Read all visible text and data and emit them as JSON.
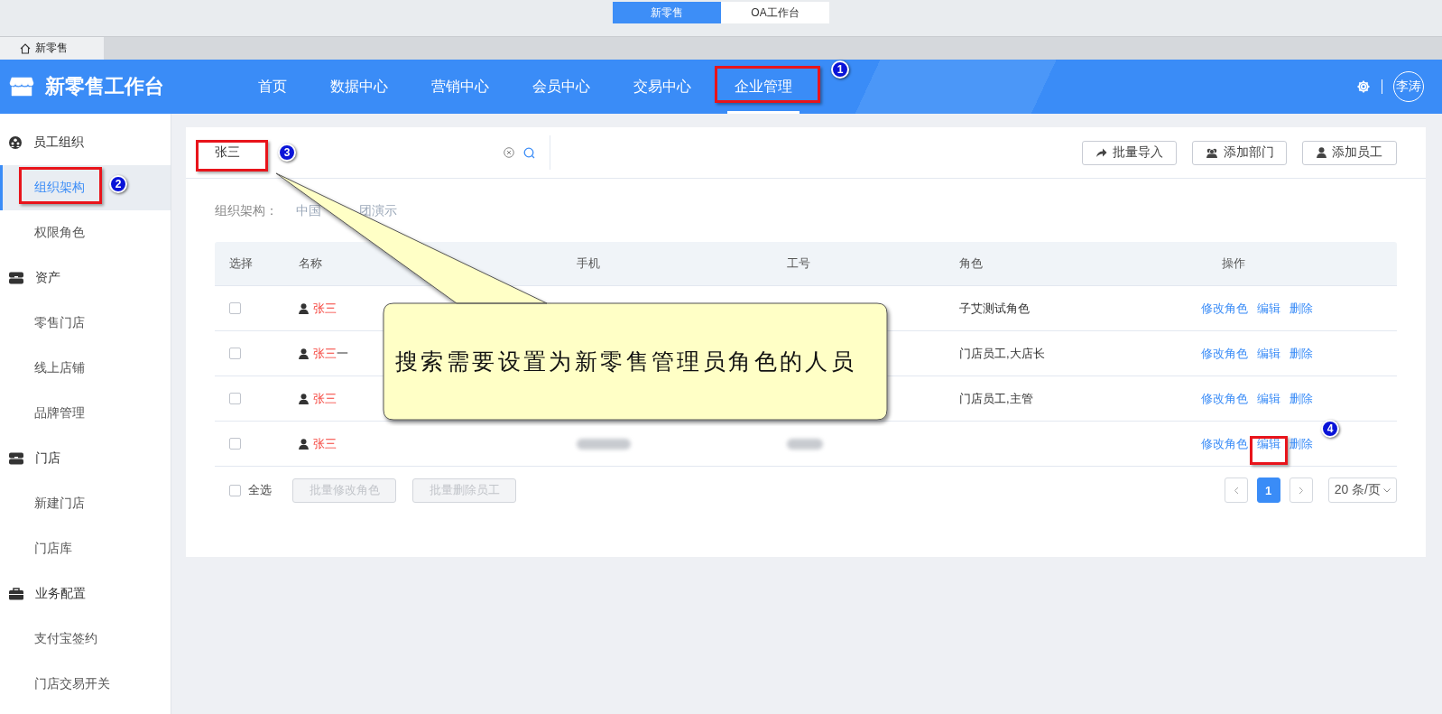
{
  "top_switch": [
    {
      "label": "新零售",
      "selected": true
    },
    {
      "label": "OA工作台",
      "selected": false
    }
  ],
  "page_tabs": [
    {
      "label": "新零售",
      "selected": true
    }
  ],
  "header": {
    "logo": "新零售工作台",
    "nav": [
      {
        "label": "首页",
        "selected": false
      },
      {
        "label": "数据中心",
        "selected": false
      },
      {
        "label": "营销中心",
        "selected": false
      },
      {
        "label": "会员中心",
        "selected": false
      },
      {
        "label": "交易中心",
        "selected": false
      },
      {
        "label": "企业管理",
        "selected": true
      }
    ],
    "user": "李涛"
  },
  "sidebar": {
    "items": [
      {
        "kind": "group",
        "label": "员工组织",
        "selected": false
      },
      {
        "kind": "item",
        "label": "组织架构",
        "selected": true
      },
      {
        "kind": "item",
        "label": "权限角色",
        "selected": false
      },
      {
        "kind": "group",
        "label": "资产",
        "selected": false
      },
      {
        "kind": "item",
        "label": "零售门店",
        "selected": false
      },
      {
        "kind": "item",
        "label": "线上店铺",
        "selected": false
      },
      {
        "kind": "item",
        "label": "品牌管理",
        "selected": false
      },
      {
        "kind": "group",
        "label": "门店",
        "selected": false
      },
      {
        "kind": "item",
        "label": "新建门店",
        "selected": false
      },
      {
        "kind": "item",
        "label": "门店库",
        "selected": false
      },
      {
        "kind": "group",
        "label": "业务配置",
        "selected": false
      },
      {
        "kind": "item",
        "label": "支付宝签约",
        "selected": false
      },
      {
        "kind": "item",
        "label": "门店交易开关",
        "selected": false
      }
    ]
  },
  "toolbar": {
    "search": {
      "value": "张三"
    },
    "buttons": [
      "批量导入",
      "添加部门",
      "添加员工"
    ]
  },
  "org_path": {
    "label": "组织架构：",
    "parts": [
      "中国",
      "团演示"
    ]
  },
  "table": {
    "columns": [
      "选择",
      "名称",
      "手机",
      "工号",
      "角色",
      "操作"
    ],
    "rows": [
      {
        "checked": false,
        "name": [
          {
            "text": "张三",
            "highlight": true
          }
        ],
        "blurred": false,
        "role": "子艾测试角色",
        "actions": [
          "修改角色",
          "编辑",
          "删除"
        ]
      },
      {
        "checked": false,
        "name": [
          {
            "text": "张三",
            "highlight": true
          },
          {
            "text": "一",
            "highlight": false
          }
        ],
        "blurred": false,
        "role": "门店员工,大店长",
        "actions": [
          "修改角色",
          "编辑",
          "删除"
        ]
      },
      {
        "checked": false,
        "name": [
          {
            "text": "张三",
            "highlight": true
          }
        ],
        "blurred": false,
        "role": "门店员工,主管",
        "actions": [
          "修改角色",
          "编辑",
          "删除"
        ]
      },
      {
        "checked": false,
        "name": [
          {
            "text": "张三",
            "highlight": true
          }
        ],
        "blurred": true,
        "role": "",
        "actions": [
          "修改角色",
          "编辑",
          "删除"
        ]
      }
    ]
  },
  "footer": {
    "select_all": {
      "label": "全选",
      "checked": false
    },
    "batch_buttons": [
      {
        "label": "批量修改角色",
        "disabled": true
      },
      {
        "label": "批量删除员工",
        "disabled": true
      }
    ],
    "pagination": {
      "pages": [
        {
          "label": "1",
          "selected": true
        }
      ],
      "page_size": "20 条/页"
    }
  },
  "annotations": {
    "markers": [
      "1",
      "2",
      "3",
      "4"
    ],
    "callout": "搜索需要设置为新零售管理员角色的人员"
  }
}
